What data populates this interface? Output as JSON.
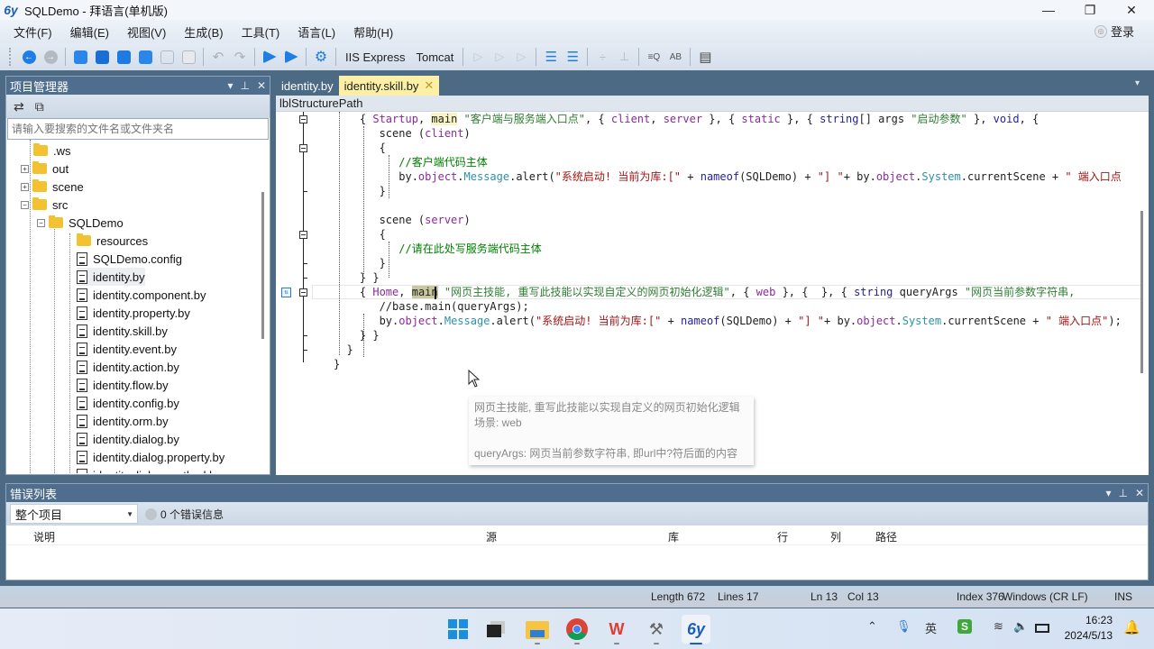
{
  "window": {
    "title": "SQLDemo - 拜语言(单机版)",
    "logo": "6y",
    "controls": {
      "minimize": "—",
      "maximize": "❐",
      "close": "✕"
    }
  },
  "menu": [
    "文件(F)",
    "编辑(E)",
    "视图(V)",
    "生成(B)",
    "工具(T)",
    "语言(L)",
    "帮助(H)"
  ],
  "login": {
    "label": "登录",
    "icon": "user-avatar-icon"
  },
  "toolbar": {
    "iis_label": "IIS Express",
    "tomcat_label": "Tomcat",
    "icons": [
      "back-icon",
      "forward-icon",
      "new-project-icon",
      "add-item-icon",
      "list-icon",
      "checklist-icon",
      "save-icon",
      "save-all-icon",
      "undo-icon",
      "redo-icon",
      "run-client-icon",
      "run-server-icon",
      "build-icon",
      "step-icon",
      "step-over-icon",
      "step-out-icon",
      "outline-icon",
      "wrap-icon",
      "collapse-icon",
      "expand-icon",
      "find-icon",
      "replace-icon",
      "layout-icon"
    ]
  },
  "project_explorer": {
    "title": "项目管理器",
    "search_placeholder": "请输入要搜索的文件名或文件夹名",
    "tree": [
      {
        "label": ".ws",
        "type": "folder",
        "level": 1,
        "expander": ""
      },
      {
        "label": "out",
        "type": "folder",
        "level": 1,
        "expander": "+"
      },
      {
        "label": "scene",
        "type": "folder",
        "level": 1,
        "expander": "+"
      },
      {
        "label": "src",
        "type": "folder",
        "level": 1,
        "expander": "-"
      },
      {
        "label": "SQLDemo",
        "type": "folder",
        "level": 2,
        "expander": "-"
      },
      {
        "label": "resources",
        "type": "folder",
        "level": 3,
        "expander": ""
      },
      {
        "label": "SQLDemo.config",
        "type": "file",
        "level": 3,
        "expander": ""
      },
      {
        "label": "identity.by",
        "type": "file",
        "level": 3,
        "expander": "",
        "selected": true
      },
      {
        "label": "identity.component.by",
        "type": "file",
        "level": 3,
        "expander": ""
      },
      {
        "label": "identity.property.by",
        "type": "file",
        "level": 3,
        "expander": ""
      },
      {
        "label": "identity.skill.by",
        "type": "file",
        "level": 3,
        "expander": ""
      },
      {
        "label": "identity.event.by",
        "type": "file",
        "level": 3,
        "expander": ""
      },
      {
        "label": "identity.action.by",
        "type": "file",
        "level": 3,
        "expander": ""
      },
      {
        "label": "identity.flow.by",
        "type": "file",
        "level": 3,
        "expander": ""
      },
      {
        "label": "identity.config.by",
        "type": "file",
        "level": 3,
        "expander": ""
      },
      {
        "label": "identity.orm.by",
        "type": "file",
        "level": 3,
        "expander": ""
      },
      {
        "label": "identity.dialog.by",
        "type": "file",
        "level": 3,
        "expander": ""
      },
      {
        "label": "identity.dialog.property.by",
        "type": "file",
        "level": 3,
        "expander": ""
      },
      {
        "label": "identity.dialog.method.by",
        "type": "file",
        "level": 3,
        "expander": ""
      }
    ]
  },
  "editor": {
    "tabs": [
      {
        "label": "identity.by",
        "active": false
      },
      {
        "label": "identity.skill.by",
        "active": true,
        "close": "✕"
      }
    ],
    "structure_path": "lblStructurePath",
    "lines": [
      [
        [
          "    { ",
          "p"
        ],
        [
          "Startup",
          "pp"
        ],
        [
          ", ",
          "p"
        ],
        [
          "main",
          "mn"
        ],
        [
          " ",
          "p"
        ],
        [
          "\"客户端与服务端入口点\"",
          "sg"
        ],
        [
          ", { ",
          "p"
        ],
        [
          "client",
          "pp"
        ],
        [
          ", ",
          "p"
        ],
        [
          "server",
          "pp"
        ],
        [
          " }, { ",
          "p"
        ],
        [
          "static",
          "pp"
        ],
        [
          " }, { ",
          "p"
        ],
        [
          "string",
          "kw"
        ],
        [
          "[] args ",
          "p"
        ],
        [
          "\"启动参数\"",
          "sg"
        ],
        [
          " }, ",
          "p"
        ],
        [
          "void",
          "kw"
        ],
        [
          ", {",
          "p"
        ]
      ],
      [
        [
          "       scene (",
          "p"
        ],
        [
          "client",
          "pp"
        ],
        [
          ")",
          "p"
        ]
      ],
      [
        [
          "       {",
          "p"
        ]
      ],
      [
        [
          "          ",
          "p"
        ],
        [
          "//客户端代码主体",
          "cm"
        ]
      ],
      [
        [
          "          by.",
          "p"
        ],
        [
          "object",
          "pp"
        ],
        [
          ".",
          "p"
        ],
        [
          "Message",
          "tp"
        ],
        [
          ".alert(",
          "p"
        ],
        [
          "\"系统启动! 当前为库:[\"",
          "st"
        ],
        [
          " + ",
          "p"
        ],
        [
          "nameof",
          "kw"
        ],
        [
          "(SQLDemo) + ",
          "p"
        ],
        [
          "\"] \"",
          "st"
        ],
        [
          "+ by.",
          "p"
        ],
        [
          "object",
          "pp"
        ],
        [
          ".",
          "p"
        ],
        [
          "System",
          "tp"
        ],
        [
          ".currentScene + ",
          "p"
        ],
        [
          "\" 端入口点",
          "st"
        ]
      ],
      [
        [
          "       }",
          "p"
        ]
      ],
      [
        [
          "",
          "p"
        ]
      ],
      [
        [
          "       scene (",
          "p"
        ],
        [
          "server",
          "pp"
        ],
        [
          ")",
          "p"
        ]
      ],
      [
        [
          "       {",
          "p"
        ]
      ],
      [
        [
          "          ",
          "p"
        ],
        [
          "//请在此处写服务端代码主体",
          "cm"
        ]
      ],
      [
        [
          "       }",
          "p"
        ]
      ],
      [
        [
          "    } }",
          "p"
        ]
      ],
      [
        [
          "    { ",
          "p"
        ],
        [
          "Home",
          "pp"
        ],
        [
          ", ",
          "p"
        ],
        [
          "main",
          "hlm"
        ],
        [
          " ",
          "p"
        ],
        [
          "\"网页主技能, 重写此技能以实现自定义的网页初始化逻辑\"",
          "sg"
        ],
        [
          ", { ",
          "p"
        ],
        [
          "web",
          "pp"
        ],
        [
          " }, {  }, { ",
          "p"
        ],
        [
          "string",
          "kw"
        ],
        [
          " queryArgs ",
          "p"
        ],
        [
          "\"网页当前参数字符串, ",
          "sg"
        ]
      ],
      [
        [
          "       //base.main(queryArgs);",
          "p"
        ]
      ],
      [
        [
          "       by.",
          "p"
        ],
        [
          "object",
          "pp"
        ],
        [
          ".",
          "p"
        ],
        [
          "Message",
          "tp"
        ],
        [
          ".alert(",
          "p"
        ],
        [
          "\"系统启动! 当前为库:[\"",
          "st"
        ],
        [
          " + ",
          "p"
        ],
        [
          "nameof",
          "kw"
        ],
        [
          "(SQLDemo) + ",
          "p"
        ],
        [
          "\"] \"",
          "st"
        ],
        [
          "+ by.",
          "p"
        ],
        [
          "object",
          "pp"
        ],
        [
          ".",
          "p"
        ],
        [
          "System",
          "tp"
        ],
        [
          ".currentScene + ",
          "p"
        ],
        [
          "\" 端入口点\"",
          "st"
        ],
        [
          ");",
          "p"
        ]
      ],
      [
        [
          "    } }",
          "p"
        ]
      ],
      [
        [
          "  }",
          "p"
        ]
      ],
      [
        [
          "}",
          "p"
        ]
      ]
    ],
    "tooltip": {
      "line1": "网页主技能, 重写此技能以实现自定义的网页初始化逻辑",
      "line2": "场景: web",
      "line3": "queryArgs: 网页当前参数字符串, 即url中?符后面的内容"
    }
  },
  "error_list": {
    "title": "错误列表",
    "scope": "整个项目",
    "count_text": "0 个错误信息",
    "columns": [
      "说明",
      "源",
      "库",
      "行",
      "列",
      "路径"
    ]
  },
  "status": {
    "length": "Length 672",
    "lines": "Lines 17",
    "ln": "Ln 13",
    "col": "Col 13",
    "index": "Index 376",
    "eol": "Windows (CR LF)",
    "mode": "INS"
  },
  "taskbar": {
    "apps": [
      "windows-start-icon",
      "task-view-icon",
      "file-explorer-icon",
      "chrome-icon",
      "wps-icon",
      "tool-icon",
      "baiyuyan-icon"
    ],
    "tray": {
      "ime": "英",
      "time": "16:23",
      "date": "2024/5/13"
    }
  }
}
